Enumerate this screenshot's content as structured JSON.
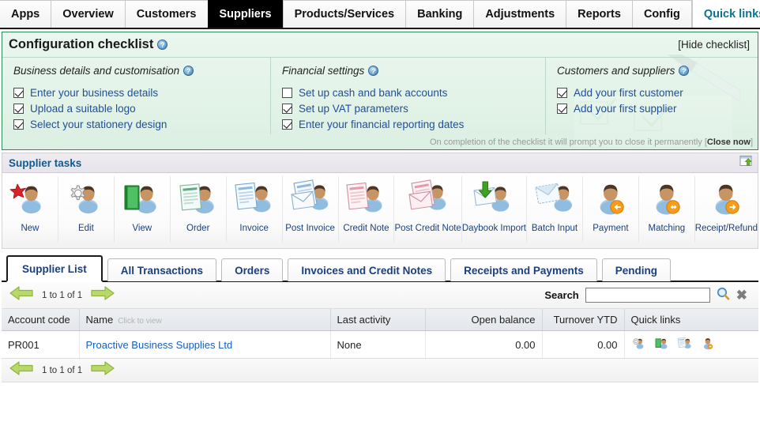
{
  "topnav": {
    "items": [
      {
        "label": "Apps",
        "active": false
      },
      {
        "label": "Overview",
        "active": false
      },
      {
        "label": "Customers",
        "active": false
      },
      {
        "label": "Suppliers",
        "active": true
      },
      {
        "label": "Products/Services",
        "active": false
      },
      {
        "label": "Banking",
        "active": false
      },
      {
        "label": "Adjustments",
        "active": false
      },
      {
        "label": "Reports",
        "active": false
      },
      {
        "label": "Config",
        "active": false
      }
    ],
    "quick_links": "Quick links"
  },
  "checklist": {
    "title": "Configuration checklist",
    "help_glyph": "?",
    "hide_label": "[Hide checklist]",
    "footer_note": "On completion of the checklist it will prompt you to close it permanently [",
    "footer_action": "Close now",
    "footer_note_end": "]",
    "columns": [
      {
        "title": "Business details and customisation",
        "items": [
          {
            "label": "Enter your business details",
            "checked": true
          },
          {
            "label": "Upload a suitable logo",
            "checked": true
          },
          {
            "label": "Select your stationery design",
            "checked": true
          }
        ]
      },
      {
        "title": "Financial settings",
        "items": [
          {
            "label": "Set up cash and bank accounts",
            "checked": false
          },
          {
            "label": "Set up VAT parameters",
            "checked": true
          },
          {
            "label": "Enter your financial reporting dates",
            "checked": true
          }
        ]
      },
      {
        "title": "Customers and suppliers",
        "items": [
          {
            "label": "Add your first customer",
            "checked": true
          },
          {
            "label": "Add your first supplier",
            "checked": true
          }
        ]
      }
    ]
  },
  "tasks": {
    "bar_title": "Supplier tasks",
    "collapse_icon": "window-collapse-icon",
    "items": [
      {
        "label": "New",
        "icon": "person-star-icon"
      },
      {
        "label": "Edit",
        "icon": "person-gear-icon"
      },
      {
        "label": "View",
        "icon": "person-book-icon"
      },
      {
        "label": "Order",
        "icon": "person-order-document-icon"
      },
      {
        "label": "Invoice",
        "icon": "person-invoice-icon"
      },
      {
        "label": "Post Invoice",
        "icon": "person-invoice-envelope-icon"
      },
      {
        "label": "Credit Note",
        "icon": "person-credit-note-icon"
      },
      {
        "label": "Post Credit Note",
        "icon": "person-credit-note-envelope-icon"
      },
      {
        "label": "Daybook Import",
        "icon": "person-import-arrow-icon"
      },
      {
        "label": "Batch Input",
        "icon": "person-batch-envelope-icon"
      },
      {
        "label": "Payment",
        "icon": "person-arrow-left-icon"
      },
      {
        "label": "Matching",
        "icon": "person-arrow-both-icon"
      },
      {
        "label": "Receipt/Refund",
        "icon": "person-arrow-right-icon"
      }
    ]
  },
  "tabs": [
    {
      "label": "Supplier List",
      "active": true
    },
    {
      "label": "All Transactions",
      "active": false
    },
    {
      "label": "Orders",
      "active": false
    },
    {
      "label": "Invoices and Credit Notes",
      "active": false
    },
    {
      "label": "Receipts and Payments",
      "active": false
    },
    {
      "label": "Pending",
      "active": false
    }
  ],
  "pager": {
    "range_text": "1 to 1 of 1",
    "prev_icon": "arrow-left-icon",
    "next_icon": "arrow-right-icon"
  },
  "search": {
    "label": "Search",
    "value": "",
    "placeholder": "",
    "search_icon": "magnifier-icon",
    "clear_icon": "close-icon",
    "clear_glyph": "✖"
  },
  "table": {
    "headers": [
      {
        "label": "Account code",
        "hint": "",
        "align": "left"
      },
      {
        "label": "Name",
        "hint": "Click to view",
        "align": "left"
      },
      {
        "label": "Last activity",
        "hint": "",
        "align": "left"
      },
      {
        "label": "Open balance",
        "hint": "",
        "align": "right"
      },
      {
        "label": "Turnover YTD",
        "hint": "",
        "align": "right"
      },
      {
        "label": "Quick links",
        "hint": "",
        "align": "left"
      }
    ],
    "rows": [
      {
        "account_code": "PR001",
        "name": "Proactive Business Supplies Ltd",
        "last_activity": "None",
        "open_balance": "0.00",
        "turnover_ytd": "0.00",
        "quick_links": [
          "edit-icon",
          "view-icon",
          "invoice-icon",
          "payment-icon"
        ]
      }
    ]
  },
  "colors": {
    "accent_blue": "#1b3f7a",
    "link_blue": "#1560bd",
    "quick_link_teal": "#0b7394",
    "checklist_border_green": "#2e8b57",
    "checklist_bg": "#e3f3e8",
    "active_tab_black": "#000000",
    "arrow_green": "#9ac43a",
    "badge_orange": "#ef8b12"
  }
}
